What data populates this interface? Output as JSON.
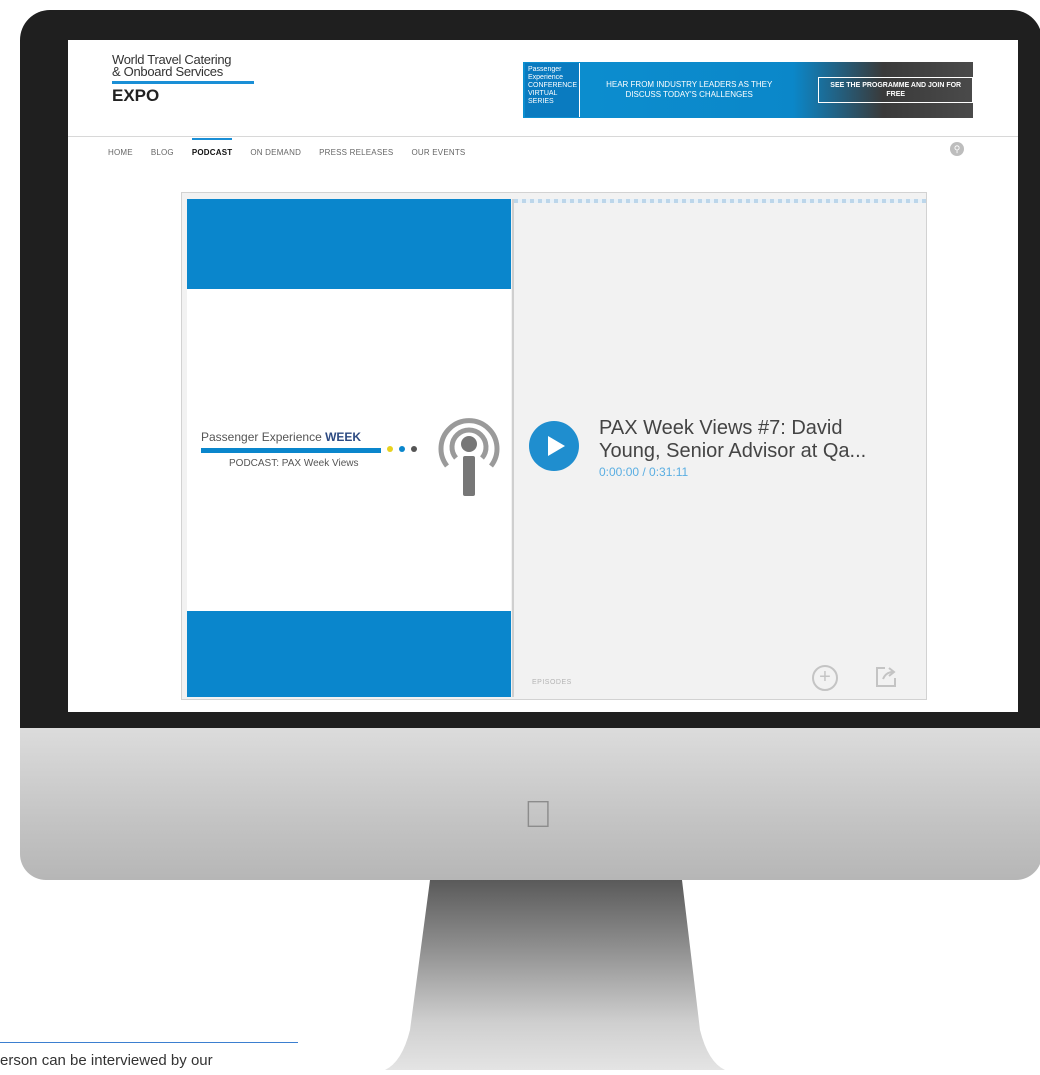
{
  "site": {
    "brand_line1": "World Travel Catering",
    "brand_line2": "& Onboard Services",
    "brand_expo": "EXPO"
  },
  "banner": {
    "logo_line1": "Passenger",
    "logo_line2": "Experience",
    "logo_line3": "CONFERENCE",
    "logo_line4": "VIRTUAL SERIES",
    "message": "HEAR FROM INDUSTRY LEADERS AS THEY DISCUSS TODAY'S CHALLENGES",
    "cta": "SEE THE PROGRAMME AND JOIN FOR FREE"
  },
  "nav": {
    "items": [
      "HOME",
      "BLOG",
      "PODCAST",
      "ON DEMAND",
      "PRESS RELEASES",
      "OUR EVENTS"
    ],
    "active": "PODCAST"
  },
  "player": {
    "art_title_main": "Passenger Experience ",
    "art_title_week": "WEEK",
    "art_subtitle": "PODCAST: PAX Week Views",
    "episode_title": "PAX Week Views #7: David Young, Senior Advisor at Qa...",
    "time": "0:00:00 / 0:31:11",
    "brand": "EPISODES",
    "colors": {
      "accent": "#0a86cc",
      "play": "#1f8ecf",
      "time": "#5aaee2"
    }
  },
  "page": {
    "bottom_text": "erson can be interviewed by our"
  }
}
